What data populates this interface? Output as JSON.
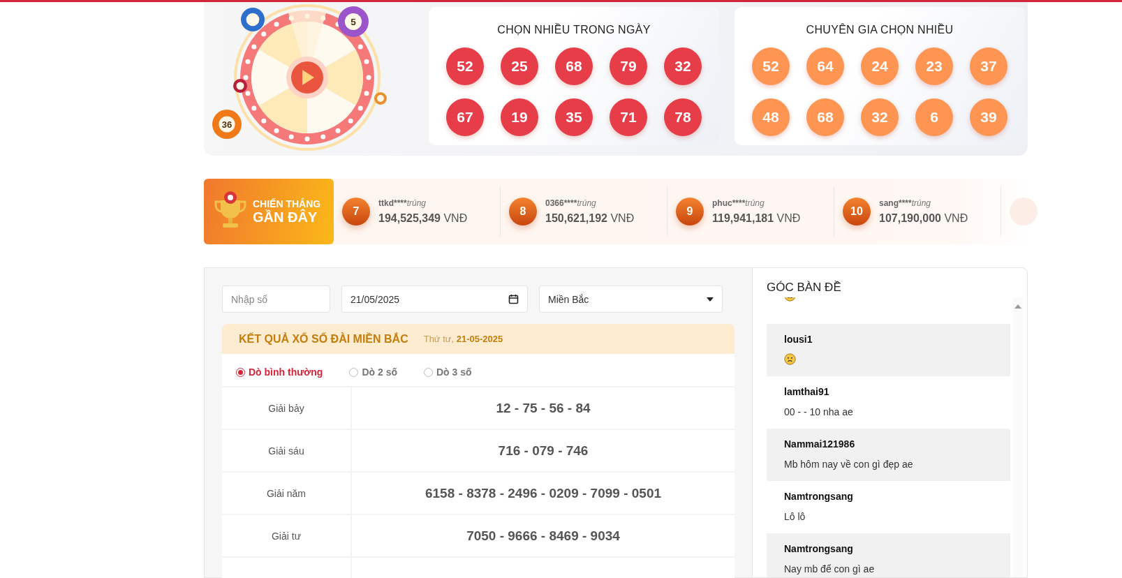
{
  "wheel": {
    "ball_numbers": [
      "5",
      "36"
    ]
  },
  "pick_cards": [
    {
      "title": "CHỌN NHIỀU TRONG NGÀY",
      "color": "#e63d48",
      "numbers": [
        "52",
        "25",
        "68",
        "79",
        "32",
        "67",
        "19",
        "35",
        "71",
        "78"
      ]
    },
    {
      "title": "CHUYÊN GIA CHỌN NHIỀU",
      "color": "#ff9552",
      "numbers": [
        "52",
        "64",
        "24",
        "23",
        "37",
        "48",
        "68",
        "32",
        "6",
        "39"
      ]
    }
  ],
  "recent_wins": {
    "title_top": "CHIẾN THẮNG",
    "title_bottom": "GẦN ĐÂY",
    "items": [
      {
        "rank": "7",
        "user": "ttkd****",
        "action": "trúng",
        "amount": "194,525,349",
        "currency": "VNĐ"
      },
      {
        "rank": "8",
        "user": "0366****",
        "action": "trúng",
        "amount": "150,621,192",
        "currency": "VNĐ"
      },
      {
        "rank": "9",
        "user": "phuc****",
        "action": "trúng",
        "amount": "119,941,181",
        "currency": "VNĐ"
      },
      {
        "rank": "10",
        "user": "sang****",
        "action": "trúng",
        "amount": "107,190,000",
        "currency": "VNĐ"
      }
    ]
  },
  "filters": {
    "number": {
      "placeholder": "Nhập số"
    },
    "date": {
      "value": "21/05/2025"
    },
    "region": {
      "value": "Miền Bắc"
    }
  },
  "results": {
    "title": "KẾT QUẢ XỔ SỐ ĐÀI MIỀN BẮC",
    "date": "Thứ tư, **21-05-2025**",
    "modes": [
      {
        "label": "Dò bình thường",
        "selected": true
      },
      {
        "label": "Dò 2 số",
        "selected": false
      },
      {
        "label": "Dò 3 số",
        "selected": false
      }
    ],
    "rows": [
      {
        "prize": "Giải bảy",
        "numbers": "12 - 75 - 56 - 84"
      },
      {
        "prize": "Giải sáu",
        "numbers": "716 - 079 - 746"
      },
      {
        "prize": "Giải năm",
        "numbers": "6158 - 8378 - 2496 - 0209 - 7099 - 0501"
      },
      {
        "prize": "Giải tư",
        "numbers": "7050 - 9666 - 8469 - 9034"
      }
    ]
  },
  "chat": {
    "title": "GÓC BÀN ĐỀ",
    "messages": [
      {
        "kind": "emoji"
      },
      {
        "kind": "emoji",
        "user": "lousi1"
      },
      {
        "kind": "text",
        "user": "lamthai91",
        "text": "00 - - 10 nha ae"
      },
      {
        "kind": "text",
        "user": "Nammai121986",
        "text": "Mb hôm nay về con gì đẹp ae"
      },
      {
        "kind": "text",
        "user": "Namtrongsang",
        "text": "Lô lô"
      },
      {
        "kind": "text",
        "user": "Namtrongsang",
        "text": "Nay mb để con gì ae"
      }
    ]
  }
}
